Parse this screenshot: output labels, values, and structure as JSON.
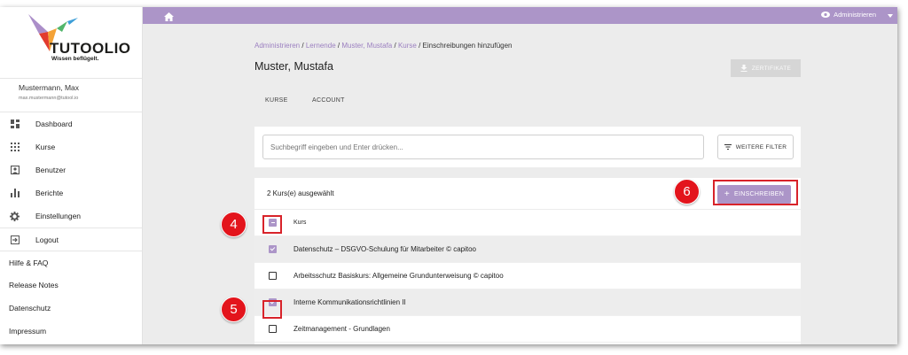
{
  "brand": {
    "name": "TUTOOLIO",
    "tagline": "Wissen beflügelt."
  },
  "user": {
    "name": "Mustermann, Max",
    "email": "max.mustermann@tutool.io"
  },
  "sidebar": {
    "items": [
      {
        "label": "Dashboard",
        "icon": "dashboard-icon"
      },
      {
        "label": "Kurse",
        "icon": "apps-grid-icon"
      },
      {
        "label": "Benutzer",
        "icon": "person-box-icon"
      },
      {
        "label": "Berichte",
        "icon": "bar-chart-icon"
      },
      {
        "label": "Einstellungen",
        "icon": "gear-icon"
      },
      {
        "label": "Logout",
        "icon": "logout-icon"
      }
    ],
    "links": [
      "Hilfe & FAQ",
      "Release Notes",
      "Datenschutz",
      "Impressum"
    ]
  },
  "topbar": {
    "role": "Administrieren"
  },
  "breadcrumb": {
    "items": [
      "Administrieren",
      "Lernende",
      "Muster, Mustafa",
      "Kurse"
    ],
    "current": "Einschreibungen hinzufügen"
  },
  "page": {
    "title": "Muster, Mustafa",
    "cert_button": "ZERTIFIKATE"
  },
  "tabs": [
    "KURSE",
    "ACCOUNT"
  ],
  "search": {
    "placeholder": "Suchbegriff eingeben und Enter drücken...",
    "filter_button": "WEITERE FILTER"
  },
  "selection": {
    "summary": "2 Kurs(e) ausgewählt",
    "enroll_button": "EINSCHREIBEN"
  },
  "table": {
    "header": "Kurs",
    "rows": [
      {
        "title": "Datenschutz – DSGVO-Schulung für Mitarbeiter © capitoo",
        "checked": true
      },
      {
        "title": "Arbeitsschutz Basiskurs: Allgemeine Grundunterweisung © capitoo",
        "checked": false
      },
      {
        "title": "Interne Kommunikationsrichtlinien II",
        "checked": true
      },
      {
        "title": "Zeitmanagement - Grundlagen",
        "checked": false
      }
    ]
  },
  "annotations": {
    "marker_4": "4",
    "marker_5": "5",
    "marker_6": "6"
  },
  "colors": {
    "accent": "#ac95c8",
    "annotation_red": "#d8232a"
  }
}
